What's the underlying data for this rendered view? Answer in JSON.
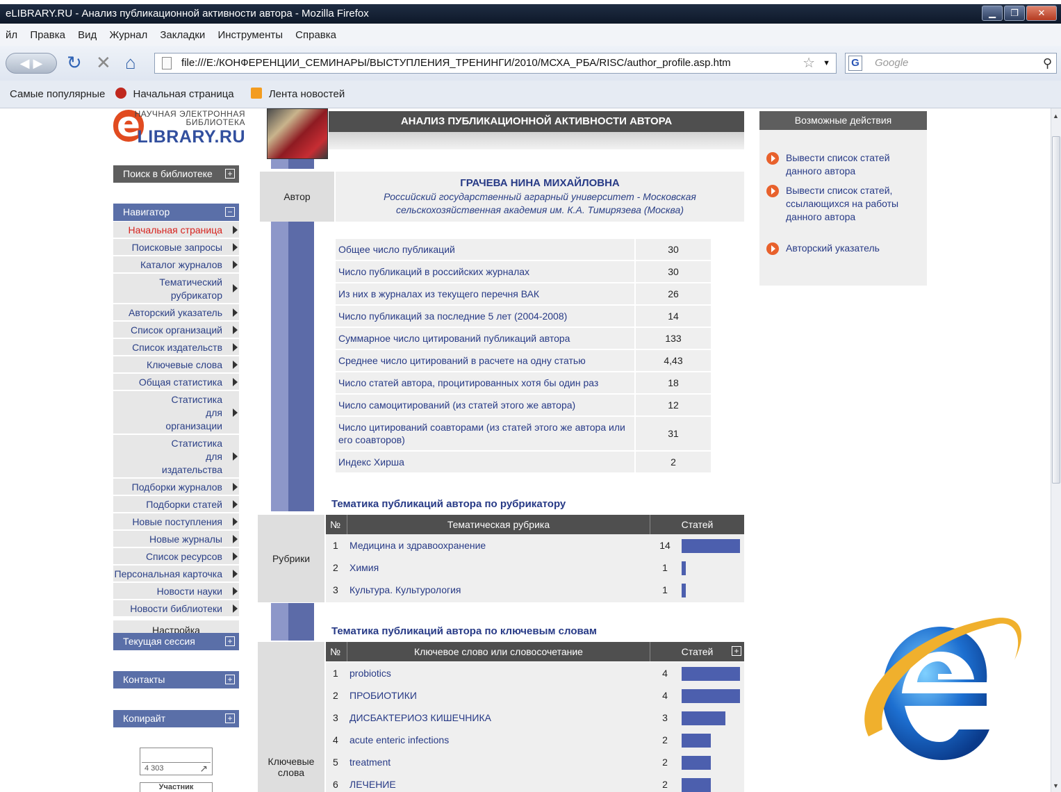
{
  "window": {
    "title": "eLIBRARY.RU - Анализ публикационной активности автора - Mozilla Firefox"
  },
  "menu": [
    "йл",
    "Правка",
    "Вид",
    "Журнал",
    "Закладки",
    "Инструменты",
    "Справка"
  ],
  "toolbar": {
    "url": "file:///E:/КОНФЕРЕНЦИИ_СЕМИНАРЫ/ВЫСТУПЛЕНИЯ_ТРЕНИНГИ/2010/МСХА_РБА/RISC/author_profile.asp.htm",
    "search_placeholder": "Google"
  },
  "bookmarks": [
    "Самые популярные",
    "Начальная страница",
    "Лента новостей"
  ],
  "logo": {
    "line1": "НАУЧНАЯ ЭЛЕКТРОННАЯ",
    "line2": "БИБЛИОТЕКА",
    "brand": "LIBRARY.RU"
  },
  "left": {
    "search_label": "Поиск в библиотеке",
    "navigator_label": "Навигатор",
    "nav_items": [
      "Начальная страница",
      "Поисковые запросы",
      "Каталог журналов",
      "Тематический рубрикатор",
      "Авторский указатель",
      "Список организаций",
      "Список издательств",
      "Ключевые слова",
      "Общая статистика",
      "Статистика для организации",
      "Статистика для издательства",
      "Подборки журналов",
      "Подборки статей",
      "Новые поступления",
      "Новые журналы",
      "Список ресурсов",
      "Персональная карточка",
      "Новости науки",
      "Новости библиотеки"
    ],
    "settings_label": "Настройка",
    "session_label": "Текущая сессия",
    "contacts_label": "Контакты",
    "copyright_label": "Копирайт",
    "counter_value": "4 303",
    "member_label": "Участник"
  },
  "main": {
    "header": "АНАЛИЗ ПУБЛИКАЦИОННОЙ АКТИВНОСТИ АВТОРА",
    "author_label": "Автор",
    "author_name": "ГРАЧЕВА НИНА МИХАЙЛОВНА",
    "author_org": "Российский государственный аграрный университет - Московская сельскохозяйственная академия им. К.А. Тимирязева (Москва)",
    "stats": [
      {
        "label": "Общее число публикаций",
        "value": "30"
      },
      {
        "label": "Число публикаций в российских журналах",
        "value": "30"
      },
      {
        "label": "Из них в журналах из текущего перечня ВАК",
        "value": "26"
      },
      {
        "label": "Число публикаций за последние 5 лет (2004-2008)",
        "value": "14"
      },
      {
        "label": "Суммарное число цитирований публикаций автора",
        "value": "133"
      },
      {
        "label": "Среднее число цитирований в расчете на одну статью",
        "value": "4,43"
      },
      {
        "label": "Число статей автора, процитированных хотя бы один раз",
        "value": "18"
      },
      {
        "label": "Число самоцитирований (из статей этого же автора)",
        "value": "12"
      },
      {
        "label": "Число цитирований соавторами (из статей этого же автора или его соавторов)",
        "value": "31"
      },
      {
        "label": "Индекс Хирша",
        "value": "2"
      }
    ],
    "rubrics_title": "Тематика публикаций автора по рубрикатору",
    "rubrics_label": "Рубрики",
    "rubrics_cols": [
      "№",
      "Тематическая рубрика",
      "Статей"
    ],
    "rubrics": [
      {
        "n": "1",
        "name": "Медицина и здравоохранение",
        "count": 14
      },
      {
        "n": "2",
        "name": "Химия",
        "count": 1
      },
      {
        "n": "3",
        "name": "Культура. Культурология",
        "count": 1
      }
    ],
    "keywords_title": "Тематика публикаций автора по ключевым словам",
    "keywords_label": "Ключевые слова",
    "keywords_cols": [
      "№",
      "Ключевое слово или словосочетание",
      "Статей"
    ],
    "keywords": [
      {
        "n": "1",
        "name": "probiotics",
        "count": 4
      },
      {
        "n": "2",
        "name": "ПРОБИОТИКИ",
        "count": 4
      },
      {
        "n": "3",
        "name": "ДИСБАКТЕРИОЗ КИШЕЧНИКА",
        "count": 3
      },
      {
        "n": "4",
        "name": "acute enteric infections",
        "count": 2
      },
      {
        "n": "5",
        "name": "treatment",
        "count": 2
      },
      {
        "n": "6",
        "name": "ЛЕЧЕНИЕ",
        "count": 2
      }
    ]
  },
  "right": {
    "header": "Возможные действия",
    "actions": [
      "Вывести список статей данного автора",
      "Вывести список статей, ссылающихся на работы данного автора",
      "Авторский указатель"
    ]
  },
  "colors": {
    "accent": "#5a6fa8",
    "bar": "#4c5fae",
    "active": "#d7231e"
  }
}
